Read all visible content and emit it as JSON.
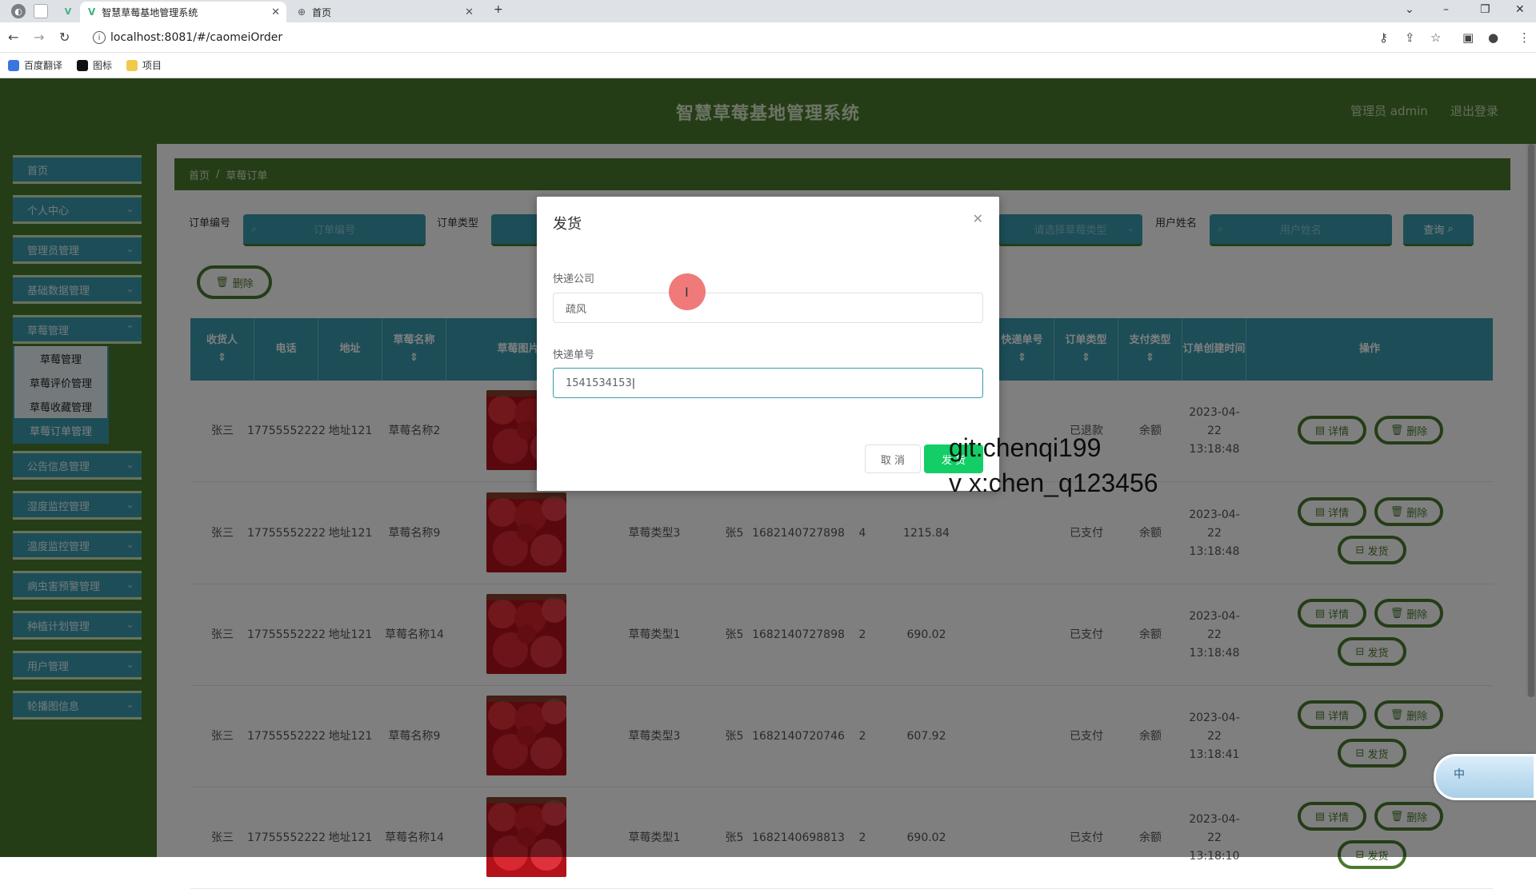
{
  "browser": {
    "tabs": [
      {
        "title": "智慧草莓基地管理系统",
        "active": true
      },
      {
        "title": "首页",
        "active": false
      }
    ],
    "url": "localhost:8081/#/caomeiOrder",
    "bookmarks": [
      "百度翻译",
      "图标",
      "项目"
    ]
  },
  "header": {
    "title": "智慧草莓基地管理系统",
    "user": "管理员 admin",
    "logout": "退出登录"
  },
  "sidebar": {
    "items": [
      {
        "label": "首页"
      },
      {
        "label": "个人中心"
      },
      {
        "label": "管理员管理"
      },
      {
        "label": "基础数据管理"
      },
      {
        "label": "草莓管理"
      },
      {
        "label": "公告信息管理"
      },
      {
        "label": "湿度监控管理"
      },
      {
        "label": "温度监控管理"
      },
      {
        "label": "病虫害预警管理"
      },
      {
        "label": "种植计划管理"
      },
      {
        "label": "用户管理"
      },
      {
        "label": "轮播图信息"
      }
    ],
    "submenu": [
      "草莓管理",
      "草莓评价管理",
      "草莓收藏管理",
      "草莓订单管理"
    ]
  },
  "breadcrumb": {
    "home": "首页",
    "sep": "/",
    "current": "草莓订单"
  },
  "search": {
    "order_no_label": "订单编号",
    "order_no_placeholder": "订单编号",
    "order_type_label": "订单类型",
    "pay_type_placeholder": "请选择草莓类型",
    "user_name_label": "用户姓名",
    "user_name_placeholder": "用户姓名",
    "query": "查询"
  },
  "toolbar": {
    "delete": "删除"
  },
  "table": {
    "headers": [
      "收货人",
      "电话",
      "地址",
      "草莓名称",
      "草莓图片",
      "快递单号",
      "订单类型",
      "支付类型",
      "订单创建时间",
      "操作"
    ],
    "rows": [
      {
        "name": "张三",
        "phone": "17755552222",
        "addr": "地址121",
        "product": "草莓名称2",
        "type": "",
        "buyer": "",
        "orderno": "",
        "qty": "",
        "price": "",
        "express": "",
        "status": "已退款",
        "pay": "余额",
        "time": "2023-04-22 13:18:48",
        "ship": false
      },
      {
        "name": "张三",
        "phone": "17755552222",
        "addr": "地址121",
        "product": "草莓名称9",
        "type": "草莓类型3",
        "buyer": "张5",
        "orderno": "1682140727898",
        "qty": "4",
        "price": "1215.84",
        "express": "",
        "status": "已支付",
        "pay": "余额",
        "time": "2023-04-22 13:18:48",
        "ship": true
      },
      {
        "name": "张三",
        "phone": "17755552222",
        "addr": "地址121",
        "product": "草莓名称14",
        "type": "草莓类型1",
        "buyer": "张5",
        "orderno": "1682140727898",
        "qty": "2",
        "price": "690.02",
        "express": "",
        "status": "已支付",
        "pay": "余额",
        "time": "2023-04-22 13:18:48",
        "ship": true
      },
      {
        "name": "张三",
        "phone": "17755552222",
        "addr": "地址121",
        "product": "草莓名称9",
        "type": "草莓类型3",
        "buyer": "张5",
        "orderno": "1682140720746",
        "qty": "2",
        "price": "607.92",
        "express": "",
        "status": "已支付",
        "pay": "余额",
        "time": "2023-04-22 13:18:41",
        "ship": true
      },
      {
        "name": "张三",
        "phone": "17755552222",
        "addr": "地址121",
        "product": "草莓名称14",
        "type": "草莓类型1",
        "buyer": "张5",
        "orderno": "1682140698813",
        "qty": "2",
        "price": "690.02",
        "express": "",
        "status": "已支付",
        "pay": "余额",
        "time": "2023-04-22 13:18:10",
        "ship": true
      }
    ],
    "actions": {
      "detail": "详情",
      "delete": "删除",
      "ship": "发货"
    }
  },
  "dialog": {
    "title": "发货",
    "company_label": "快递公司",
    "company_value": "疏风",
    "number_label": "快递单号",
    "number_value": "1541534153",
    "cancel": "取 消",
    "confirm": "发 货"
  },
  "watermark": {
    "line1": "git:chenqi199",
    "line2": "v x:chen_q123456"
  },
  "ime": {
    "label": "中"
  },
  "colors": {
    "green": "#4a7a2e",
    "teal": "#3a9cb0",
    "confirm": "#13ce66"
  }
}
